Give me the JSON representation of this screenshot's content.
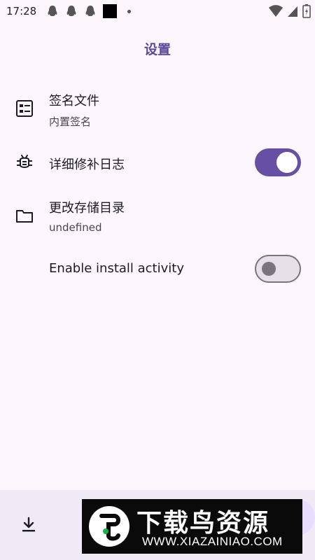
{
  "status_bar": {
    "time": "17:28",
    "notification_icons": [
      "qq-icon",
      "qq-icon",
      "qq-icon",
      "app-square-icon",
      "dot-icon"
    ],
    "right_icons": [
      "wifi-icon",
      "signal-icon",
      "battery-icon"
    ]
  },
  "header": {
    "title": "设置"
  },
  "settings": {
    "signature_file": {
      "title": "签名文件",
      "subtitle": "内置签名",
      "icon": "document-list-icon"
    },
    "verbose_log": {
      "title": "详细修补日志",
      "icon": "bug-icon",
      "enabled": true
    },
    "storage_dir": {
      "title": "更改存储目录",
      "subtitle": "undefined",
      "icon": "folder-icon"
    },
    "install_activity": {
      "title": "Enable install activity",
      "enabled": false
    }
  },
  "bottom": {
    "icon": "download-icon"
  },
  "watermark": {
    "title": "下载鸟资源",
    "url": "WWW.XIAZAINIAO.COM"
  },
  "colors": {
    "accent": "#6750a4",
    "title": "#5b4a9a",
    "background": "#fdf7fd"
  }
}
